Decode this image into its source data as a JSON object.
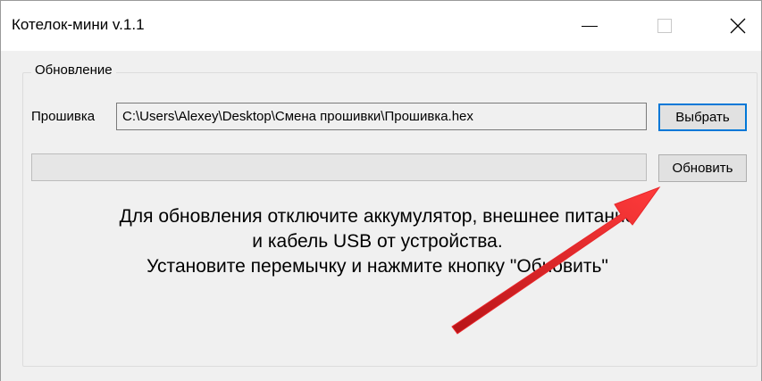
{
  "window": {
    "title": "Котелок-мини v.1.1"
  },
  "titlebar_buttons": {
    "minimize_icon": "minimize-icon",
    "maximize_icon": "maximize-icon",
    "close_icon": "close-icon"
  },
  "update_group": {
    "legend": "Обновление",
    "firmware_label": "Прошивка",
    "firmware_path": "C:\\Users\\Alexey\\Desktop\\Смена прошивки\\Прошивка.hex",
    "select_button": "Выбрать",
    "update_button": "Обновить",
    "progress_fraction": 0
  },
  "instructions": {
    "line1": "Для обновления отключите аккумулятор, внешнее питание",
    "line2": "и кабель USB от устройства.",
    "line3": "Установите перемычку и нажмите кнопку \"Обновить\""
  },
  "annotation": {
    "arrow_color": "#e8262a"
  }
}
